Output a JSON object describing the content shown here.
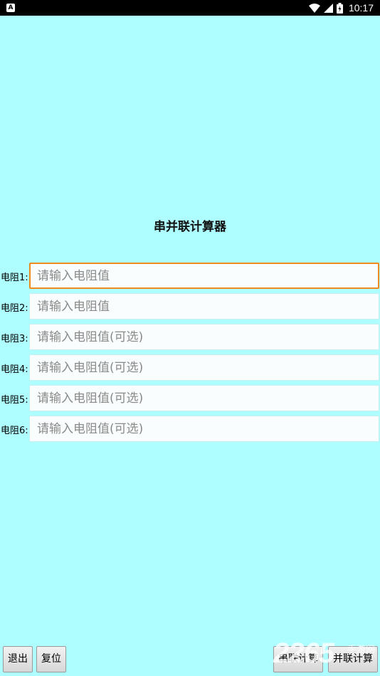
{
  "status_bar": {
    "app_icon": "A",
    "time": "10:17",
    "icons": [
      "wifi-icon",
      "signal-icon",
      "battery-icon"
    ]
  },
  "title": "串并联计算器",
  "resistors": [
    {
      "label": "电阻1:",
      "placeholder": "请输入电阻值",
      "value": ""
    },
    {
      "label": "电阻2:",
      "placeholder": "请输入电阻值",
      "value": ""
    },
    {
      "label": "电阻3:",
      "placeholder": "请输入电阻值(可选)",
      "value": ""
    },
    {
      "label": "电阻4:",
      "placeholder": "请输入电阻值(可选)",
      "value": ""
    },
    {
      "label": "电阻5:",
      "placeholder": "请输入电阻值(可选)",
      "value": ""
    },
    {
      "label": "电阻6:",
      "placeholder": "请输入电阻值(可选)",
      "value": ""
    }
  ],
  "buttons": {
    "exit": "退出",
    "reset": "复位",
    "series": "串联计算",
    "parallel": "并联计算"
  },
  "watermark": {
    "number": "2265",
    "text": "手游网"
  },
  "colors": {
    "background": "#aefeff",
    "focus_border": "#f08a1c",
    "status_bar": "#000000"
  }
}
